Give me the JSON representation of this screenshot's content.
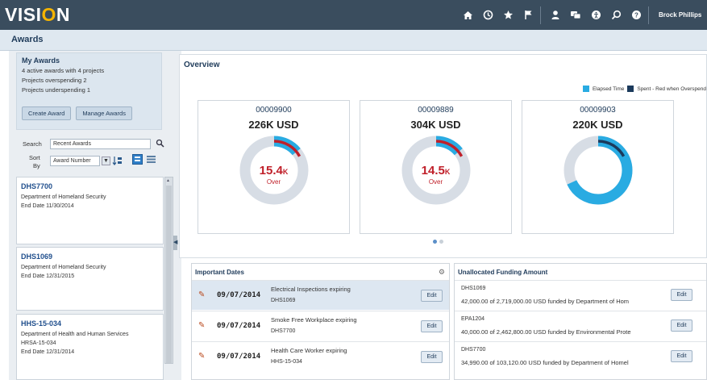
{
  "header": {
    "logo_prefix": "VISI",
    "logo_o": "O",
    "logo_suffix": "N",
    "icons": [
      "home-icon",
      "recent-icon",
      "favorites-icon",
      "flag-icon",
      "user-icon",
      "chat-icon",
      "accessibility-icon",
      "search-icon",
      "help-icon"
    ],
    "username": "Brock Phillips"
  },
  "page": {
    "title": "Awards"
  },
  "my_awards": {
    "title": "My Awards",
    "line1": "4 active awards with 4 projects",
    "line2_label": "Projects overspending",
    "line2_value": "2",
    "line3_label": "Projects underspending",
    "line3_value": "1",
    "create_label": "Create Award",
    "manage_label": "Manage Awards"
  },
  "search": {
    "search_label": "Search",
    "search_value": "Recent Awards",
    "sort_label_1": "Sort",
    "sort_label_2": "By",
    "sort_value": "Award Number"
  },
  "award_cards": [
    {
      "id": "DHS7700",
      "dept": "Department of Homeland Security",
      "extra": "",
      "end_label": "End Date",
      "end_date": "11/30/2014"
    },
    {
      "id": "DHS1069",
      "dept": "Department of Homeland Security",
      "extra": "",
      "end_label": "End Date",
      "end_date": "12/31/2015"
    },
    {
      "id": "HHS-15-034",
      "dept": "Department of Health and Human Services",
      "extra": "HRSA-15-034",
      "end_label": "End Date",
      "end_date": "12/31/2014"
    }
  ],
  "overview": {
    "title": "Overview",
    "legend_elapsed": "Elapsed Time",
    "legend_spent": "Spent - Red when Overspend",
    "colors": {
      "elapsed": "#29abe2",
      "spent": "#1b3a5c",
      "over": "#c0202a",
      "track": "#d7dde5"
    },
    "cards": [
      {
        "number": "00009900",
        "amount": "226K USD",
        "big": "15.4",
        "big_unit": "K",
        "status": "Over",
        "elapsed": 0.14,
        "spent": 0.17,
        "overspend": true
      },
      {
        "number": "00009889",
        "amount": "304K USD",
        "big": "14.5",
        "big_unit": "K",
        "status": "Over",
        "elapsed": 0.14,
        "spent": 0.17,
        "overspend": true
      },
      {
        "number": "00009903",
        "amount": "220K USD",
        "big": "",
        "big_unit": "",
        "status": "",
        "elapsed": 0.68,
        "spent": 0.17,
        "overspend": false
      }
    ]
  },
  "important_dates": {
    "title": "Important Dates",
    "rows": [
      {
        "date": "09/07/2014",
        "text": "Electrical Inspections expiring",
        "ref": "DHS1069",
        "edit": "Edit"
      },
      {
        "date": "09/07/2014",
        "text": "Smoke Free Workplace expiring",
        "ref": "DHS7700",
        "edit": "Edit"
      },
      {
        "date": "09/07/2014",
        "text": "Health Care Worker expiring",
        "ref": "HHS-15-034",
        "edit": "Edit"
      }
    ]
  },
  "unallocated": {
    "title": "Unallocated Funding Amount",
    "rows": [
      {
        "id": "DHS1069",
        "text": "42,000.00 of 2,719,000.00 USD funded by Department of Hom",
        "edit": "Edit"
      },
      {
        "id": "EPA1204",
        "text": "40,000.00 of 2,462,800.00 USD funded by Environmental Prote",
        "edit": "Edit"
      },
      {
        "id": "DHS7700",
        "text": "34,990.00 of 103,120.00 USD funded by Department of Homel",
        "edit": "Edit"
      }
    ]
  }
}
